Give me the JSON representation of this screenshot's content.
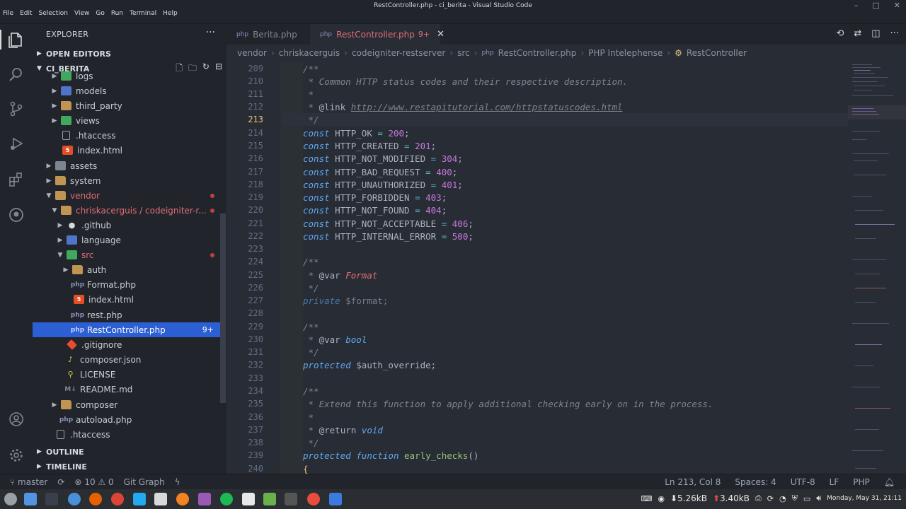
{
  "window": {
    "title": "RestController.php - ci_berita - Visual Studio Code",
    "menu": [
      "File",
      "Edit",
      "Selection",
      "View",
      "Go",
      "Run",
      "Terminal",
      "Help"
    ]
  },
  "sidebar": {
    "title": "EXPLORER",
    "sections": {
      "open_editors": "OPEN EDITORS",
      "project": "CI_BERITA",
      "outline": "OUTLINE",
      "timeline": "TIMELINE"
    },
    "tree": [
      {
        "label": "logs"
      },
      {
        "label": "models"
      },
      {
        "label": "third_party"
      },
      {
        "label": "views"
      },
      {
        "label": ".htaccess"
      },
      {
        "label": "index.html"
      },
      {
        "label": "assets"
      },
      {
        "label": "system"
      },
      {
        "label": "vendor"
      },
      {
        "label": "chriskacerguis / codeigniter-r..."
      },
      {
        "label": ".github"
      },
      {
        "label": "language"
      },
      {
        "label": "src"
      },
      {
        "label": "auth"
      },
      {
        "label": "Format.php"
      },
      {
        "label": "index.html"
      },
      {
        "label": "rest.php"
      },
      {
        "label": "RestController.php",
        "badge": "9+"
      },
      {
        "label": ".gitignore"
      },
      {
        "label": "composer.json"
      },
      {
        "label": "LICENSE"
      },
      {
        "label": "README.md"
      },
      {
        "label": "composer"
      },
      {
        "label": "autoload.php"
      },
      {
        "label": ".htaccess"
      }
    ]
  },
  "tabs": [
    {
      "label": "Berita.php"
    },
    {
      "label": "RestController.php",
      "badge": "9+"
    }
  ],
  "breadcrumbs": [
    "vendor",
    "chriskacerguis",
    "codeigniter-restserver",
    "src",
    "RestController.php",
    "PHP Intelephense",
    "RestController"
  ],
  "editor": {
    "line_numbers": [
      "209",
      "210",
      "211",
      "212",
      "213",
      "214",
      "215",
      "216",
      "217",
      "218",
      "219",
      "220",
      "221",
      "222",
      "223",
      "224",
      "225",
      "226",
      "227",
      "228",
      "229",
      "230",
      "231",
      "232",
      "233",
      "234",
      "235",
      "236",
      "237",
      "238",
      "239",
      "240"
    ],
    "current_line": "213",
    "consts": [
      {
        "name": "HTTP_OK",
        "value": "200"
      },
      {
        "name": "HTTP_CREATED",
        "value": "201"
      },
      {
        "name": "HTTP_NOT_MODIFIED",
        "value": "304"
      },
      {
        "name": "HTTP_BAD_REQUEST",
        "value": "400"
      },
      {
        "name": "HTTP_UNAUTHORIZED",
        "value": "401"
      },
      {
        "name": "HTTP_FORBIDDEN",
        "value": "403"
      },
      {
        "name": "HTTP_NOT_FOUND",
        "value": "404"
      },
      {
        "name": "HTTP_NOT_ACCEPTABLE",
        "value": "406"
      },
      {
        "name": "HTTP_INTERNAL_ERROR",
        "value": "500"
      }
    ],
    "text": {
      "doc_open": "/**",
      "doc_star": " *",
      "doc_close": " */",
      "desc1": " Common HTTP status codes and their respective description.",
      "link_tag": "@link",
      "link_url": "http://www.restapitutorial.com/httpstatuscodes.html",
      "const_kw": "const",
      "var_tag": "@var",
      "format_type": "Format",
      "private_kw": "private",
      "format_var": "$format",
      "bool_type": "bool",
      "protected_kw": "protected",
      "auth_var": "$auth_override",
      "desc2": " Extend this function to apply additional checking early on in the process.",
      "return_tag": "@return",
      "void_type": "void",
      "function_kw": "function",
      "fn_name": "early_checks",
      "brace": "{"
    }
  },
  "statusbar": {
    "branch": "master",
    "problems": "10",
    "warnings": "0",
    "git_graph": "Git Graph",
    "cursor": "Ln 213, Col 8",
    "spaces": "Spaces: 4",
    "encoding": "UTF-8",
    "eol": "LF",
    "language": "PHP"
  },
  "taskbar": {
    "net_down": "5.26kB",
    "net_up": "3.40kB",
    "clock": "Monday, May 31, 21:11"
  },
  "colors": {
    "accent": "#2c5fd3",
    "modified": "#e06c75",
    "keyword": "#5fa9f2",
    "number": "#c678dd",
    "function": "#98c379"
  }
}
